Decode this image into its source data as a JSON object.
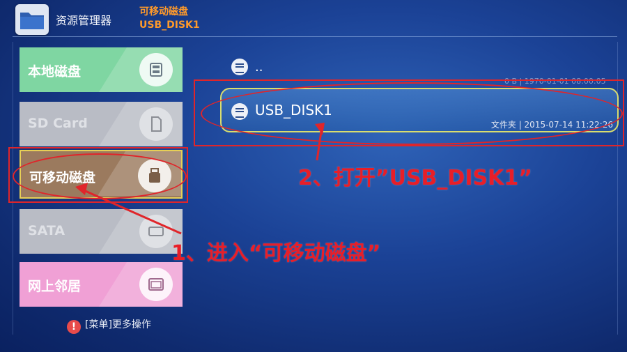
{
  "header": {
    "app_title": "资源管理器",
    "crumb_line1": "可移动磁盘",
    "crumb_line2": "USB_DISK1"
  },
  "sidebar": {
    "items": [
      {
        "label": "本地磁盘",
        "icon": "sd-card-icon",
        "color": "#7fd6a2"
      },
      {
        "label": "SD Card",
        "icon": "sd-card-icon",
        "color": "#b9bcc5"
      },
      {
        "label": "可移动磁盘",
        "icon": "usb-drive-icon",
        "color": "#9b7a5e",
        "selected": true
      },
      {
        "label": "SATA",
        "icon": "sata-icon",
        "color": "#b9bcc5"
      },
      {
        "label": "网上邻居",
        "icon": "network-icon",
        "color": "#f0a0d5"
      }
    ],
    "menu_hint": "[菜单]更多操作"
  },
  "files": {
    "parent": {
      "name": "..",
      "meta": "0 B | 1970-01-01 08:00:05"
    },
    "items": [
      {
        "name": "USB_DISK1",
        "meta": "文件夹 | 2015-07-14 11:22:26"
      }
    ]
  },
  "annotations": {
    "step1": "1、进入“可移动磁盘”",
    "step2": "2、打开”USB_DISK1”",
    "color": "#e81e28"
  }
}
